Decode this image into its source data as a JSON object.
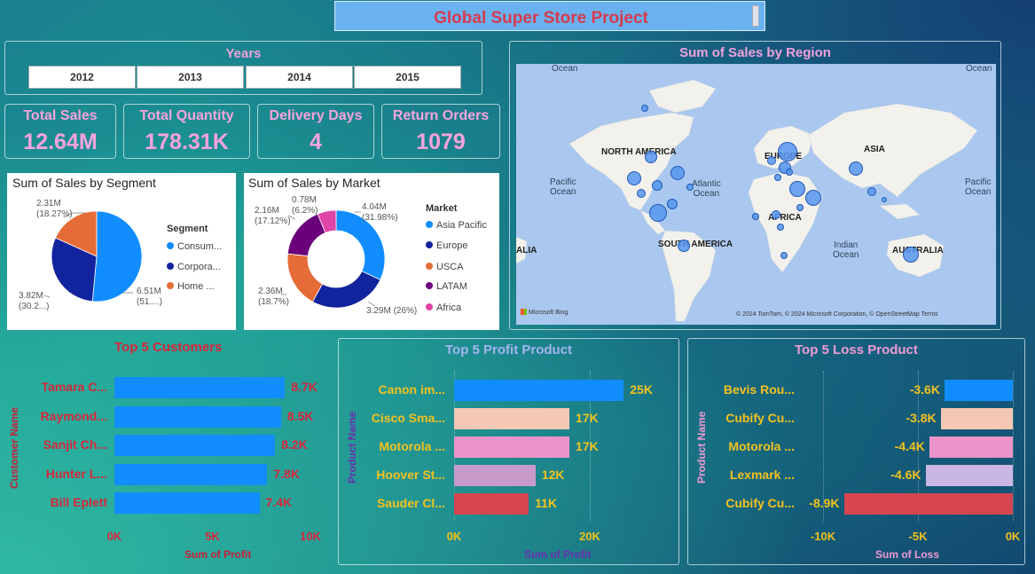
{
  "title": "Global Super Store Project",
  "years": {
    "header": "Years",
    "options": [
      "2012",
      "2013",
      "2014",
      "2015"
    ]
  },
  "kpis": [
    {
      "label": "Total Sales",
      "value": "12.64M"
    },
    {
      "label": "Total Quantity",
      "value": "178.31K"
    },
    {
      "label": "Delivery Days",
      "value": "4"
    },
    {
      "label": "Return Orders",
      "value": "1079"
    }
  ],
  "segment_chart": {
    "title": "Sum of Sales by Segment",
    "legend_title": "Segment",
    "legend": [
      "Consum...",
      "Corpora...",
      "Home ..."
    ],
    "slice_labels": [
      {
        "value": "6.51M",
        "pct": "(51....)"
      },
      {
        "value": "3.82M",
        "pct": "(30.2...)"
      },
      {
        "value": "2.31M",
        "pct": "(18.27%)"
      }
    ]
  },
  "market_chart": {
    "title": "Sum of Sales by Market",
    "legend_title": "Market",
    "legend": [
      "Asia Pacific",
      "Europe",
      "USCA",
      "LATAM",
      "Africa"
    ],
    "slice_labels": [
      {
        "value": "4.04M",
        "pct": "(31.98%)"
      },
      {
        "value": "3.29M (26%)",
        "pct": ""
      },
      {
        "value": "2.36M",
        "pct": "(18.7%)"
      },
      {
        "value": "2.16M",
        "pct": "(17.12%)"
      },
      {
        "value": "0.78M",
        "pct": "(6.2%)"
      }
    ]
  },
  "map": {
    "title": "Sum of Sales by Region",
    "labels": {
      "ocean_tl": "Ocean",
      "ocean_tr": "Ocean",
      "north_america": "NORTH AMERICA",
      "europe": "EUROPE",
      "asia": "ASIA",
      "africa": "AFRICA",
      "south_america": "SOUTH AMERICA",
      "australia": "AUSTRALIA",
      "alia": "ALIA",
      "pacific_l": "Pacific\nOcean",
      "atlantic": "Atlantic\nOcean",
      "indian": "Indian\nOcean",
      "pacific_r": "Pacific\nOcean"
    },
    "attribution": "© 2024 TomTom, © 2024 Microsoft Corporation, © OpenStreetMap  Terms",
    "logo": "Microsoft Bing"
  },
  "chart_data": [
    {
      "type": "bar",
      "title": "Top 5 Customers",
      "categories": [
        "Tamara C...",
        "Raymond...",
        "Sanjit Ch...",
        "Hunter L...",
        "Bill Eplett"
      ],
      "values": [
        8.7,
        8.5,
        8.2,
        7.8,
        7.4
      ],
      "value_labels": [
        "8.7K",
        "8.5K",
        "8.2K",
        "7.8K",
        "7.4K"
      ],
      "xlabel": "Sum of Profit",
      "ylabel": "Customer Name",
      "ticks": [
        "0K",
        "5K",
        "10K"
      ],
      "xlim": [
        0,
        10
      ],
      "colors": [
        "#118dff",
        "#118dff",
        "#118dff",
        "#118dff",
        "#118dff"
      ]
    },
    {
      "type": "bar",
      "title": "Top 5 Profit Product",
      "categories": [
        "Canon im...",
        "Cisco Sma...",
        "Motorola ...",
        "Hoover St...",
        "Sauder Cl..."
      ],
      "values": [
        25,
        17,
        17,
        12,
        11
      ],
      "value_labels": [
        "25K",
        "17K",
        "17K",
        "12K",
        "11K"
      ],
      "xlabel": "Sum of Profit",
      "ylabel": "Product Name",
      "ticks": [
        "0K",
        "20K"
      ],
      "xlim": [
        0,
        30
      ],
      "colors": [
        "#118dff",
        "#f4c8b2",
        "#ec93c9",
        "#c89ac9",
        "#d64550"
      ]
    },
    {
      "type": "bar",
      "title": "Top 5 Loss Product",
      "categories": [
        "Bevis Rou...",
        "Cubify Cu...",
        "Motorola ...",
        "Lexmark ...",
        "Cubify Cu..."
      ],
      "values": [
        -3.6,
        -3.8,
        -4.4,
        -4.6,
        -8.9
      ],
      "value_labels": [
        "-3.6K",
        "-3.8K",
        "-4.4K",
        "-4.6K",
        "-8.9K"
      ],
      "xlabel": "Sum of Loss",
      "ylabel": "Product Name",
      "ticks": [
        "-10K",
        "-5K",
        "0K"
      ],
      "xlim": [
        -10,
        0
      ],
      "colors": [
        "#118dff",
        "#f4c8b2",
        "#ec93c9",
        "#c9b6e4",
        "#d64550"
      ]
    }
  ],
  "colors": {
    "segment": [
      "#118dff",
      "#12239e",
      "#e66c37"
    ],
    "market": [
      "#118dff",
      "#12239e",
      "#e66c37",
      "#6b007b",
      "#e044a7"
    ]
  }
}
